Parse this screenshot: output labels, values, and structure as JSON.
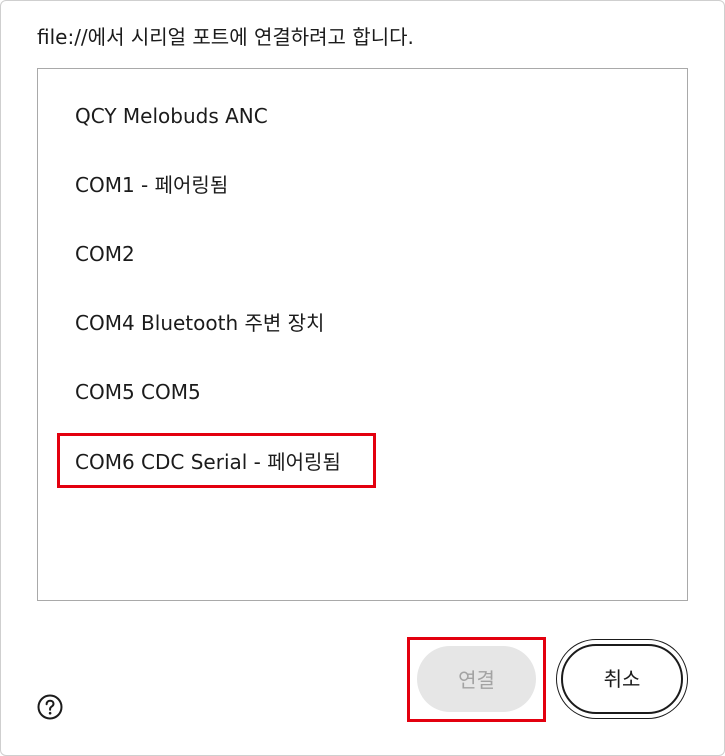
{
  "dialog": {
    "title": "file://에서 시리얼 포트에 연결하려고 합니다."
  },
  "ports": [
    {
      "label": "QCY Melobuds ANC"
    },
    {
      "label": "COM1 - 페어링됨"
    },
    {
      "label": "COM2"
    },
    {
      "label": "COM4 Bluetooth 주변 장치"
    },
    {
      "label": "COM5 COM5"
    },
    {
      "label": "COM6 CDC Serial - 페어링됨"
    }
  ],
  "buttons": {
    "connect_label": "연결",
    "cancel_label": "취소"
  },
  "icons": {
    "help": "help-icon"
  },
  "colors": {
    "highlight": "#e3000f",
    "disabled_bg": "#e6e6e6",
    "disabled_text": "#a3a3a3"
  }
}
